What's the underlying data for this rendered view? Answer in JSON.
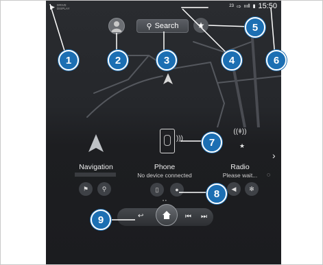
{
  "status_bar": {
    "time": "15:50",
    "ind1": "23",
    "ind2": "⇨",
    "signal": "ıııll",
    "battery": "▮"
  },
  "top": {
    "search_label": "Search",
    "drive_display_label": "DRIVE DISPLAY"
  },
  "widgets": {
    "navigation": {
      "label": "Navigation"
    },
    "phone": {
      "label": "Phone",
      "sub": "No device connected"
    },
    "radio": {
      "label": "Radio",
      "sub": "Please wait..."
    }
  },
  "callouts": [
    "1",
    "2",
    "3",
    "4",
    "5",
    "6",
    "7",
    "8",
    "9"
  ],
  "icons": {
    "more": "›"
  }
}
